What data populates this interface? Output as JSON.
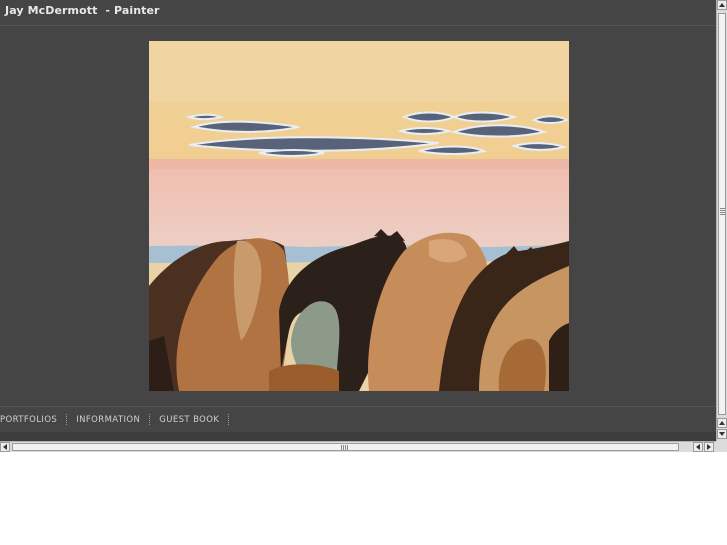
{
  "header": {
    "title": "Jay McDermott  - Painter"
  },
  "painting": {
    "colors": {
      "sky": "#efcf8e",
      "sea_band": "#efc8bd",
      "clouds": "#5b6578",
      "rock_tan": "#c58e5f",
      "rock_dark": "#2e2119",
      "rock_brown": "#9a5f2e",
      "water": "#a9bfd0",
      "cave": "#8a9886"
    }
  },
  "nav": {
    "items": [
      {
        "label": "PORTFOLIOS"
      },
      {
        "label": "INFORMATION"
      },
      {
        "label": "GUEST BOOK"
      }
    ]
  },
  "scrollbars": {
    "up_icon": "arrow-up",
    "down_icon": "arrow-down",
    "left_icon": "arrow-left",
    "right_icon": "arrow-right"
  }
}
